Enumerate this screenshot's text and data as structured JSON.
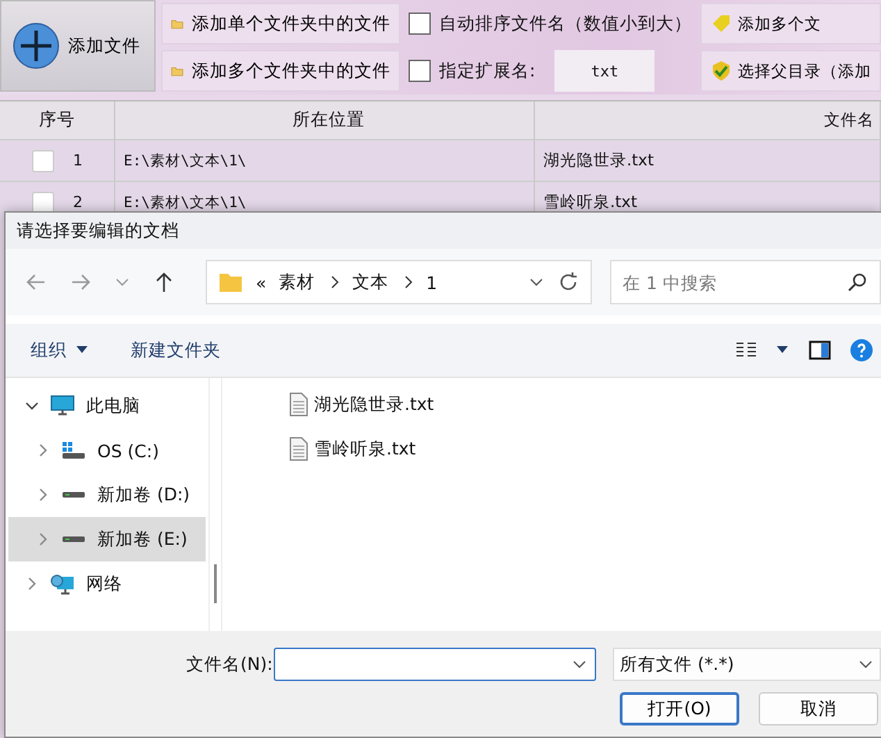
{
  "app": {
    "add_button": "添加文件",
    "tool_buttons": [
      {
        "label": "添加单个文件夹中的文件",
        "kind": "folder"
      },
      {
        "label": "添加多个文件夹中的文件",
        "kind": "folder"
      }
    ],
    "options": [
      {
        "kind": "checkbox",
        "label": "自动排序文件名（数值小到大）",
        "checked": false
      },
      {
        "kind": "extension",
        "label": "指定扩展名:",
        "checked": false,
        "value": "txt"
      }
    ],
    "right_buttons": [
      {
        "label": "添加多个文",
        "kind": "tag"
      },
      {
        "label": "选择父目录（添加",
        "kind": "shield"
      }
    ],
    "table": {
      "columns": [
        "序号",
        "所在位置",
        "文件名"
      ],
      "rows": [
        {
          "index": "1",
          "location": "E:\\素材\\文本\\1\\",
          "name": "湖光隐世录.txt",
          "checked": false
        },
        {
          "index": "2",
          "location": "E:\\素材\\文本\\1\\",
          "name": "雪岭听泉.txt",
          "checked": false
        }
      ]
    }
  },
  "dialog": {
    "title": "请选择要编辑的文档",
    "breadcrumb": [
      "«",
      "素材",
      "文本",
      "1"
    ],
    "search": {
      "placeholder": "在 1 中搜索"
    },
    "toolbar": {
      "organize": "组织",
      "new_folder": "新建文件夹"
    },
    "sidebar": [
      {
        "label": "此电脑",
        "kind": "pc",
        "expanded": true,
        "selected": false,
        "children": [
          {
            "label": "OS (C:)",
            "kind": "os",
            "expanded": false,
            "selected": false
          },
          {
            "label": "新加卷 (D:)",
            "kind": "drive",
            "expanded": false,
            "selected": false
          },
          {
            "label": "新加卷 (E:)",
            "kind": "drive",
            "expanded": false,
            "selected": true
          }
        ]
      },
      {
        "label": "网络",
        "kind": "network",
        "expanded": false,
        "selected": false
      }
    ],
    "files": [
      "湖光隐世录.txt",
      "雪岭听泉.txt"
    ],
    "filename_label": "文件名(N):",
    "file_type": "所有文件 (*.*)",
    "buttons": [
      "打开(O)",
      "取消"
    ]
  }
}
